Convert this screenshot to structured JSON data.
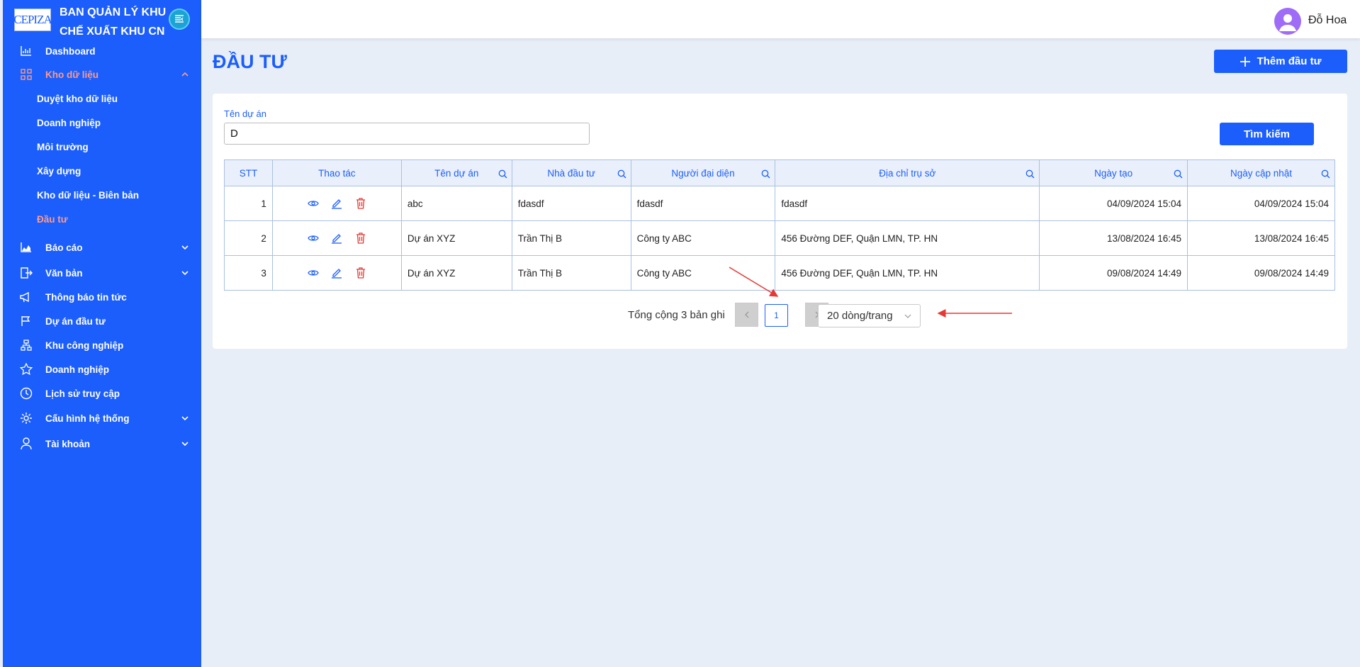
{
  "brand": {
    "logo_text": "CEPIZA",
    "name": "BAN QUẢN LÝ KHU CHẾ XUẤT KHU CN"
  },
  "sidebar": {
    "items": [
      {
        "label": "Dashboard",
        "icon": "bar-chart-icon"
      },
      {
        "label": "Kho dữ liệu",
        "icon": "grid-icon",
        "expanded": true,
        "children": [
          "Duyệt kho dữ liệu",
          "Doanh nghiệp",
          "Môi trường",
          "Xây dựng",
          "Kho dữ liệu - Biên bản",
          "Đầu tư"
        ]
      },
      {
        "label": "Báo cáo",
        "icon": "area-chart-icon"
      },
      {
        "label": "Văn bản",
        "icon": "document-arrow-icon"
      },
      {
        "label": "Thông báo tin tức",
        "icon": "megaphone-icon"
      },
      {
        "label": "Dự án đầu tư",
        "icon": "flag-icon"
      },
      {
        "label": "Khu công nghiệp",
        "icon": "org-chart-icon"
      },
      {
        "label": "Doanh nghiệp",
        "icon": "star-icon"
      },
      {
        "label": "Lịch sử truy cập",
        "icon": "clock-icon"
      },
      {
        "label": "Cấu hình hệ thống",
        "icon": "gear-icon"
      },
      {
        "label": "Tài khoản",
        "icon": "user-icon"
      }
    ],
    "active_child": "Đầu tư"
  },
  "header": {
    "username": "Đỗ Hoa"
  },
  "page": {
    "title": "ĐẦU TƯ",
    "add_button": "Thêm đầu tư"
  },
  "filter": {
    "label": "Tên dự án",
    "value": "D",
    "search_button": "Tìm kiếm"
  },
  "table": {
    "columns": [
      "STT",
      "Thao tác",
      "Tên dự án",
      "Nhà đầu tư",
      "Người đại diện",
      "Địa chỉ trụ sở",
      "Ngày tạo",
      "Ngày cập nhật"
    ],
    "rows": [
      {
        "stt": "1",
        "ten_du_an": "abc",
        "nha_dau_tu": "fdasdf",
        "nguoi_dai_dien": "fdasdf",
        "dia_chi": "fdasdf",
        "ngay_tao": "04/09/2024 15:04",
        "ngay_cap_nhat": "04/09/2024 15:04"
      },
      {
        "stt": "2",
        "ten_du_an": "Dự án XYZ",
        "nha_dau_tu": "Trần Thị B",
        "nguoi_dai_dien": "Công ty ABC",
        "dia_chi": "456 Đường DEF, Quận LMN, TP. HN",
        "ngay_tao": "13/08/2024 16:45",
        "ngay_cap_nhat": "13/08/2024 16:45"
      },
      {
        "stt": "3",
        "ten_du_an": "Dự án XYZ",
        "nha_dau_tu": "Trần Thị B",
        "nguoi_dai_dien": "Công ty ABC",
        "dia_chi": "456 Đường DEF, Quận LMN, TP. HN",
        "ngay_tao": "09/08/2024 14:49",
        "ngay_cap_nhat": "09/08/2024 14:49"
      }
    ]
  },
  "pagination": {
    "total_text": "Tổng cộng 3 bản ghi",
    "current_page": "1",
    "page_size": "20 dòng/trang"
  },
  "colors": {
    "primary": "#1b5efc",
    "active": "#ff9a8a",
    "delete": "#e53935",
    "annotation_arrow": "#e53935"
  }
}
